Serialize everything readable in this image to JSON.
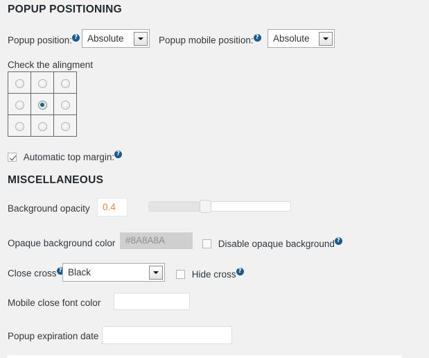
{
  "sections": {
    "positioning": {
      "title": "POPUP POSITIONING",
      "popup_position": {
        "label": "Popup position:",
        "help_icon": "help-question-icon",
        "value": "Absolute"
      },
      "popup_mobile_position": {
        "label": "Popup mobile position:",
        "help_icon": "help-question-icon",
        "value": "Absolute"
      },
      "alignment": {
        "label": "Check the alingment",
        "cells": [
          {
            "id": "top-left",
            "selected": false
          },
          {
            "id": "top-center",
            "selected": false
          },
          {
            "id": "top-right",
            "selected": false
          },
          {
            "id": "middle-left",
            "selected": false
          },
          {
            "id": "middle-center",
            "selected": true
          },
          {
            "id": "middle-right",
            "selected": false
          },
          {
            "id": "bottom-left",
            "selected": false
          },
          {
            "id": "bottom-center",
            "selected": false
          },
          {
            "id": "bottom-right",
            "selected": false
          }
        ]
      },
      "automatic_top_margin": {
        "label": "Automatic top margin:",
        "checked": true,
        "help_icon": "help-question-icon"
      }
    },
    "miscellaneous": {
      "title": "MISCELLANEOUS",
      "background_opacity": {
        "label": "Background opacity",
        "value": "0.4",
        "slider_percent": 40
      },
      "opaque_background_color": {
        "label": "Opaque background color",
        "value": "#8A8A8A",
        "disabled": true
      },
      "disable_opaque_background": {
        "label": "Disable opaque background",
        "checked": false,
        "help_icon": "help-question-icon"
      },
      "close_cross": {
        "label": "Close cross",
        "help_icon": "help-question-icon",
        "value": "Black"
      },
      "hide_cross": {
        "label": "Hide cross",
        "checked": false,
        "help_icon": "help-question-icon"
      },
      "mobile_close_font_color": {
        "label": "Mobile close font color",
        "value": ""
      },
      "popup_expiration_date": {
        "label": "Popup expiration date",
        "value": ""
      }
    }
  },
  "colors": {
    "page_background": "#f1f1f1",
    "heading_text": "#23282d",
    "body_text": "#32373c",
    "accent_orange": "#e8883a",
    "help_icon_blue": "#1c5a8c",
    "radio_selected": "#14647c"
  }
}
